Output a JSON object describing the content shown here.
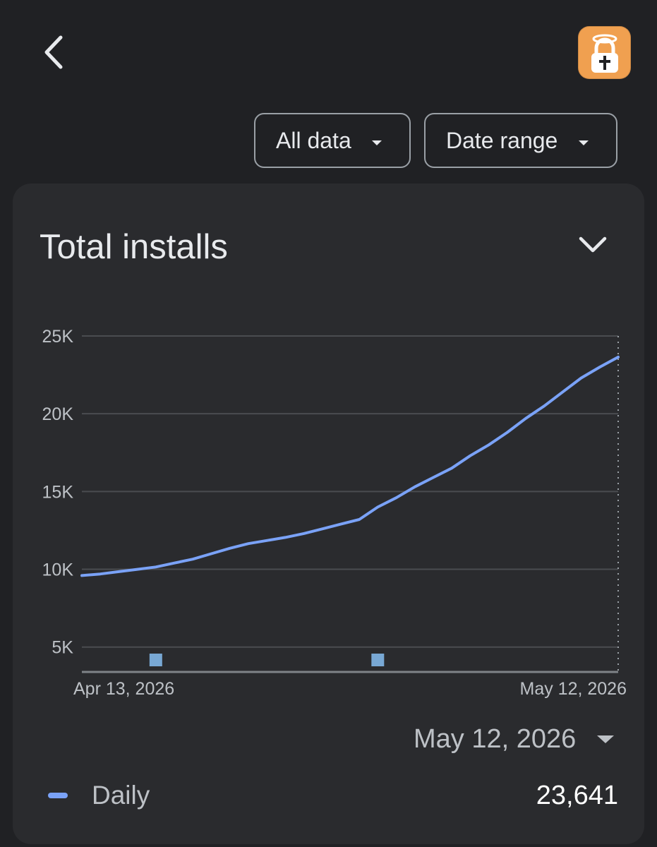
{
  "header": {
    "back_icon": "chevron-left-icon",
    "app_icon": "lock-with-halo-and-cross-icon",
    "app_icon_color": "#f0a050"
  },
  "filters": {
    "all_data_label": "All data",
    "date_range_label": "Date range"
  },
  "card": {
    "title": "Total installs",
    "collapse_icon": "chevron-down-icon"
  },
  "chart_data": {
    "type": "line",
    "title": "Total installs",
    "xlabel": "",
    "ylabel": "",
    "ylim": [
      3400,
      25000
    ],
    "y_ticks": [
      {
        "value": 25000,
        "label": "25K"
      },
      {
        "value": 20000,
        "label": "20K"
      },
      {
        "value": 15000,
        "label": "15K"
      },
      {
        "value": 10000,
        "label": "10K"
      },
      {
        "value": 5000,
        "label": "5K"
      }
    ],
    "x_tick_labels": [
      "Apr 13, 2026",
      "May 12, 2026"
    ],
    "grid": true,
    "series": [
      {
        "name": "Daily",
        "color": "#7aa2f7",
        "x": [
          "2026-04-13",
          "2026-04-14",
          "2026-04-15",
          "2026-04-16",
          "2026-04-17",
          "2026-04-18",
          "2026-04-19",
          "2026-04-20",
          "2026-04-21",
          "2026-04-22",
          "2026-04-23",
          "2026-04-24",
          "2026-04-25",
          "2026-04-26",
          "2026-04-27",
          "2026-04-28",
          "2026-04-29",
          "2026-04-30",
          "2026-05-01",
          "2026-05-02",
          "2026-05-03",
          "2026-05-04",
          "2026-05-05",
          "2026-05-06",
          "2026-05-07",
          "2026-05-08",
          "2026-05-09",
          "2026-05-10",
          "2026-05-11",
          "2026-05-12"
        ],
        "values": [
          9600,
          9700,
          9850,
          10000,
          10150,
          10400,
          10650,
          11000,
          11350,
          11650,
          11850,
          12050,
          12300,
          12600,
          12900,
          13200,
          14000,
          14600,
          15300,
          15900,
          16500,
          17300,
          18000,
          18800,
          19700,
          20500,
          21400,
          22300,
          23000,
          23641
        ]
      }
    ],
    "annotations": [
      {
        "date": "2026-04-17",
        "marker": "square"
      },
      {
        "date": "2026-04-29",
        "marker": "square"
      }
    ],
    "selected_date": "May 12, 2026",
    "selected_value": "23,641"
  },
  "legend": {
    "label": "Daily",
    "value": "23,641",
    "date": "May 12, 2026"
  },
  "colors": {
    "background": "#202124",
    "card": "#2a2b2e",
    "line": "#7aa2f7",
    "marker": "#78a8d4"
  }
}
